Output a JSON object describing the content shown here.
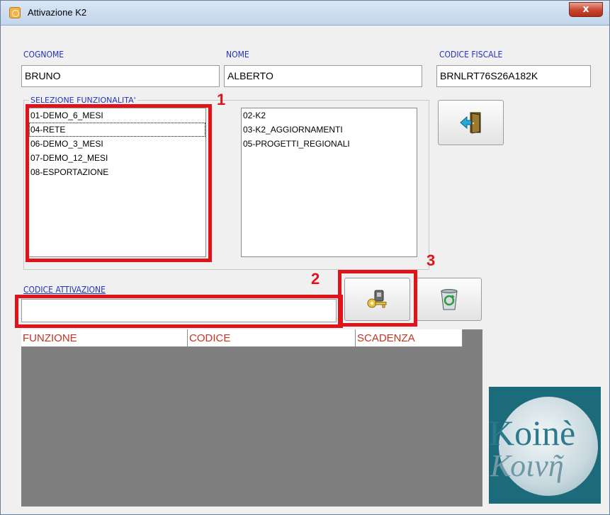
{
  "window": {
    "title": "Attivazione K2",
    "close_glyph": "x"
  },
  "fields": {
    "cognome": {
      "label": "COGNOME",
      "value": "BRUNO"
    },
    "nome": {
      "label": "NOME",
      "value": "ALBERTO"
    },
    "codice_fiscale": {
      "label": "CODICE FISCALE",
      "value": "BRNLRT76S26A182K"
    }
  },
  "selezione": {
    "title": "SELEZIONE FUNZIONALITA'",
    "available": [
      "01-DEMO_6_MESI",
      "04-RETE",
      "06-DEMO_3_MESI",
      "07-DEMO_12_MESI",
      "08-ESPORTAZIONE"
    ],
    "selected": [
      "02-K2",
      "03-K2_AGGIORNAMENTI",
      "05-PROGETTI_REGIONALI"
    ]
  },
  "codice_attivazione": {
    "label": "CODICE ATTIVAZIONE",
    "value": ""
  },
  "grid": {
    "columns": [
      "FUNZIONE",
      "CODICE",
      "SCADENZA"
    ]
  },
  "annotations": [
    "1",
    "2",
    "3"
  ],
  "logo": {
    "line1": "Koinè",
    "line2": "Κοινῆ"
  },
  "icons": {
    "exit": "exit-door-icon",
    "activate": "key-activate-icon",
    "delete": "recycle-bin-icon"
  },
  "colors": {
    "label_blue": "#2233bb",
    "annotation_red": "#e0131a",
    "grid_header_text": "#c2351f",
    "grid_bg": "#7f7f7f"
  }
}
